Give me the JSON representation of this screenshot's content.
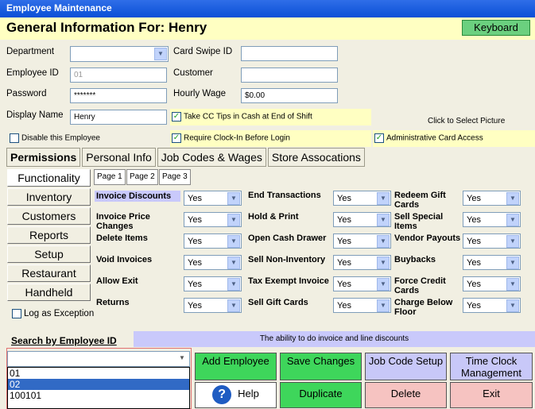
{
  "window": {
    "title": "Employee Maintenance"
  },
  "header": {
    "title": "General Information For: Henry",
    "keyboard_label": "Keyboard"
  },
  "form": {
    "department_label": "Department",
    "department_value": "",
    "card_swipe_label": "Card Swipe ID",
    "card_swipe_value": "",
    "employee_id_label": "Employee ID",
    "employee_id_value": "01",
    "customer_label": "Customer",
    "customer_value": "",
    "password_label": "Password",
    "password_value": "*******",
    "hourly_wage_label": "Hourly Wage",
    "hourly_wage_value": "$0.00",
    "display_name_label": "Display Name",
    "display_name_value": "Henry",
    "cc_tips_label": "Take CC Tips in Cash at End of Shift",
    "click_picture_label": "Click to Select Picture",
    "disable_label": "Disable this Employee",
    "require_clockin_label": "Require Clock-In Before Login",
    "admin_card_label": "Administrative Card Access"
  },
  "tabs": [
    "Permissions",
    "Personal Info",
    "Job Codes & Wages",
    "Store Assocations"
  ],
  "pages": [
    "Page 1",
    "Page 2",
    "Page 3"
  ],
  "side_buttons": [
    "Functionality",
    "Inventory",
    "Customers",
    "Reports",
    "Setup",
    "Restaurant",
    "Handheld"
  ],
  "log_exception_label": "Log as Exception",
  "permissions": [
    [
      {
        "label": "Invoice Discounts",
        "value": "Yes"
      },
      {
        "label": "Invoice Price Changes",
        "value": "Yes"
      },
      {
        "label": "Delete Items",
        "value": "Yes"
      },
      {
        "label": "Void Invoices",
        "value": "Yes"
      },
      {
        "label": "Allow Exit",
        "value": "Yes"
      },
      {
        "label": "Returns",
        "value": "Yes"
      }
    ],
    [
      {
        "label": "End Transactions",
        "value": "Yes"
      },
      {
        "label": "Hold & Print",
        "value": "Yes"
      },
      {
        "label": "Open Cash Drawer",
        "value": "Yes"
      },
      {
        "label": "Sell Non-Inventory",
        "value": "Yes"
      },
      {
        "label": "Tax Exempt Invoice",
        "value": "Yes"
      },
      {
        "label": "Sell Gift Cards",
        "value": "Yes"
      }
    ],
    [
      {
        "label": "Redeem Gift Cards",
        "value": "Yes"
      },
      {
        "label": "Sell Special Items",
        "value": "Yes"
      },
      {
        "label": "Vendor Payouts",
        "value": "Yes"
      },
      {
        "label": "Buybacks",
        "value": "Yes"
      },
      {
        "label": "Force Credit Cards",
        "value": "Yes"
      },
      {
        "label": "Charge Below Floor",
        "value": "Yes"
      }
    ]
  ],
  "status_text": "The ability to do invoice and line discounts",
  "search": {
    "label": "Search by Employee ID",
    "value": "",
    "items": [
      "01",
      "02",
      "100101"
    ],
    "selected": "02"
  },
  "buttons": {
    "add_employee": "Add Employee",
    "save_changes": "Save Changes",
    "job_code_setup": "Job Code Setup",
    "time_clock": "Time Clock Management",
    "help": "Help",
    "duplicate": "Duplicate",
    "delete": "Delete",
    "exit": "Exit"
  }
}
